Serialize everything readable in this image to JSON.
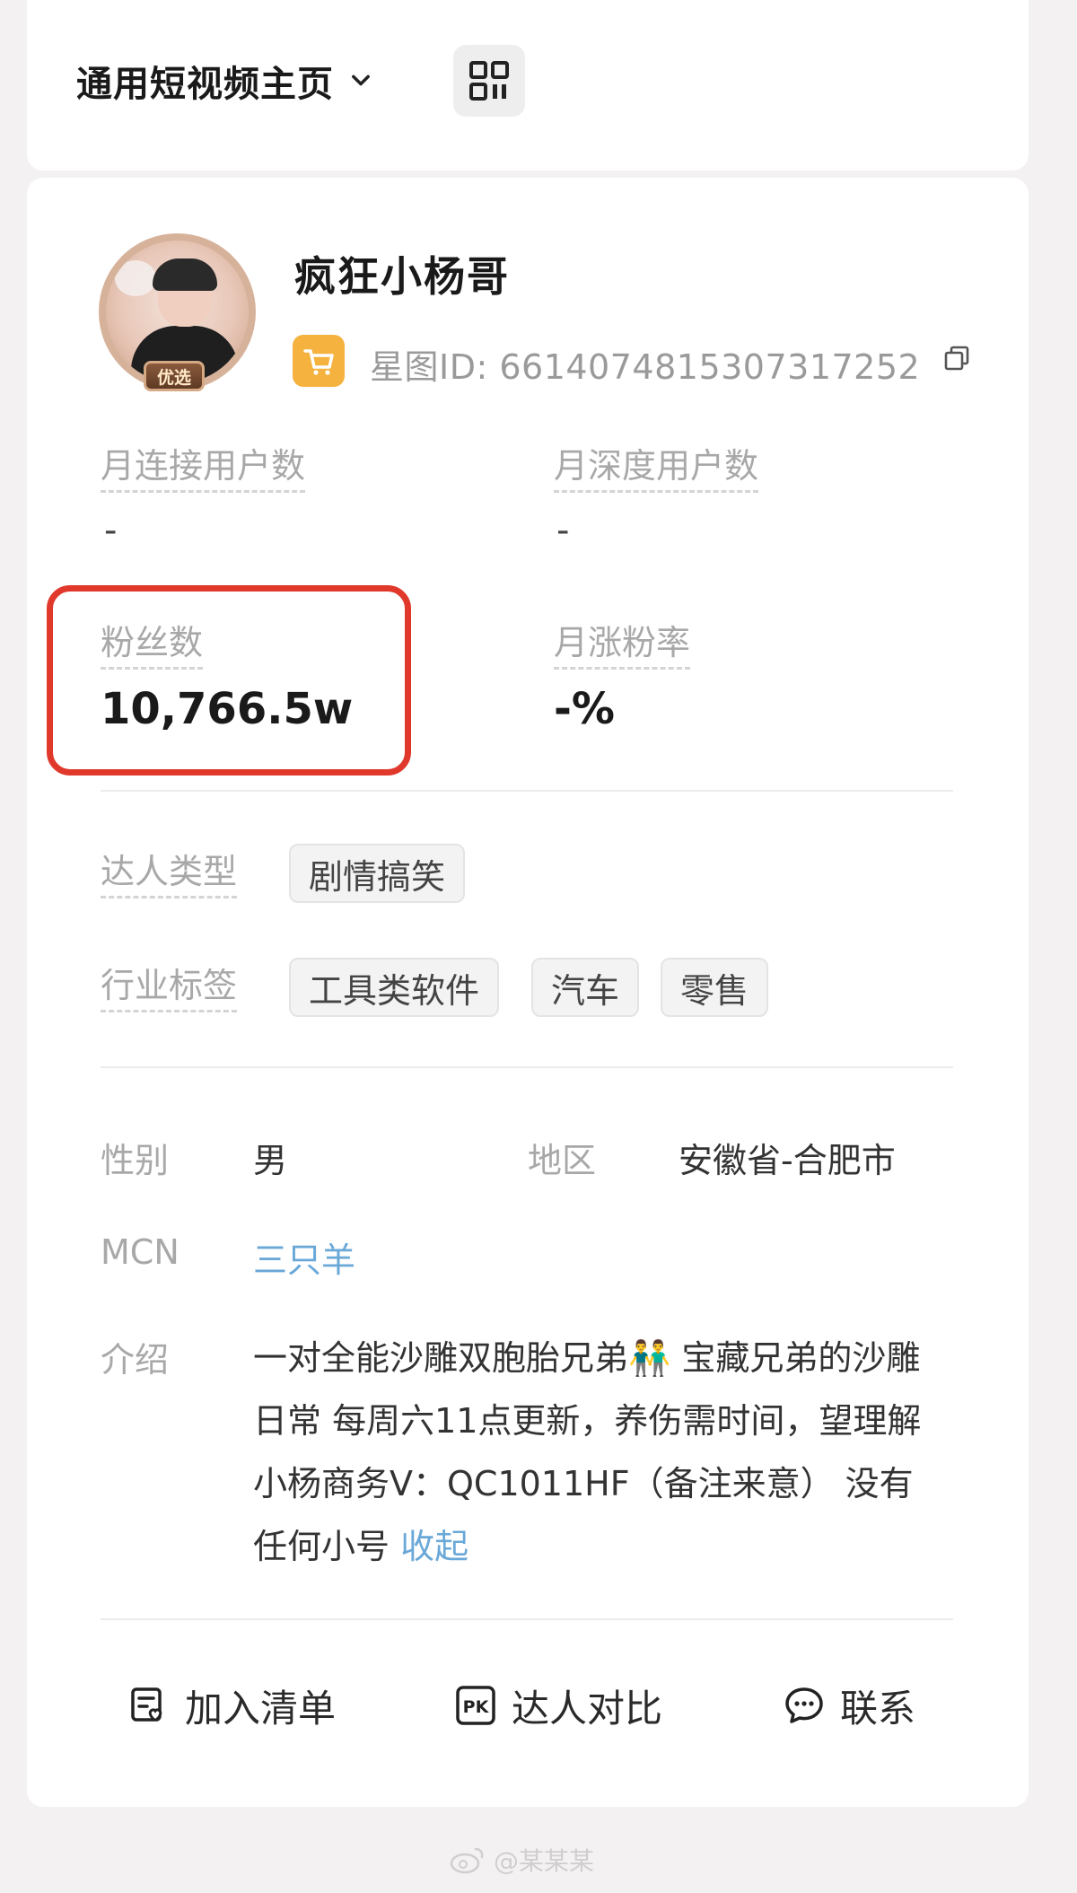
{
  "header": {
    "page_select_label": "通用短视频主页"
  },
  "profile": {
    "nickname": "疯狂小杨哥",
    "avatar_badge": "优选",
    "star_id": "星图ID: 6614074815307317252"
  },
  "stats": {
    "monthly_connected_users": {
      "label": "月连接用户数",
      "value": "-"
    },
    "monthly_deep_users": {
      "label": "月深度用户数",
      "value": "-"
    },
    "followers": {
      "label": "粉丝数",
      "value": "10,766.5w"
    },
    "monthly_follower_growth": {
      "label": "月涨粉率",
      "value": "-%"
    }
  },
  "tags": {
    "creator_type_label": "达人类型",
    "creator_type": [
      "剧情搞笑"
    ],
    "industry_label": "行业标签",
    "industry": [
      "工具类软件",
      "汽车",
      "零售"
    ]
  },
  "info": {
    "gender_label": "性别",
    "gender": "男",
    "region_label": "地区",
    "region": "安徽省-合肥市",
    "mcn_label": "MCN",
    "mcn": "三只羊",
    "intro_label": "介绍",
    "intro_text": "一对全能沙雕双胞胎兄弟👬 宝藏兄弟的沙雕日常 每周六11点更新，养伤需时间，望理解 小杨商务V：QC1011HF（备注来意） 没有任何小号",
    "collapse_label": "收起"
  },
  "actions": {
    "add_list": "加入清单",
    "compare": "达人对比",
    "contact": "联系"
  },
  "watermark": "@某某某",
  "colors": {
    "highlight": "#e0392b",
    "link": "#6aa8d8",
    "shop_badge": "#f5b23f"
  }
}
